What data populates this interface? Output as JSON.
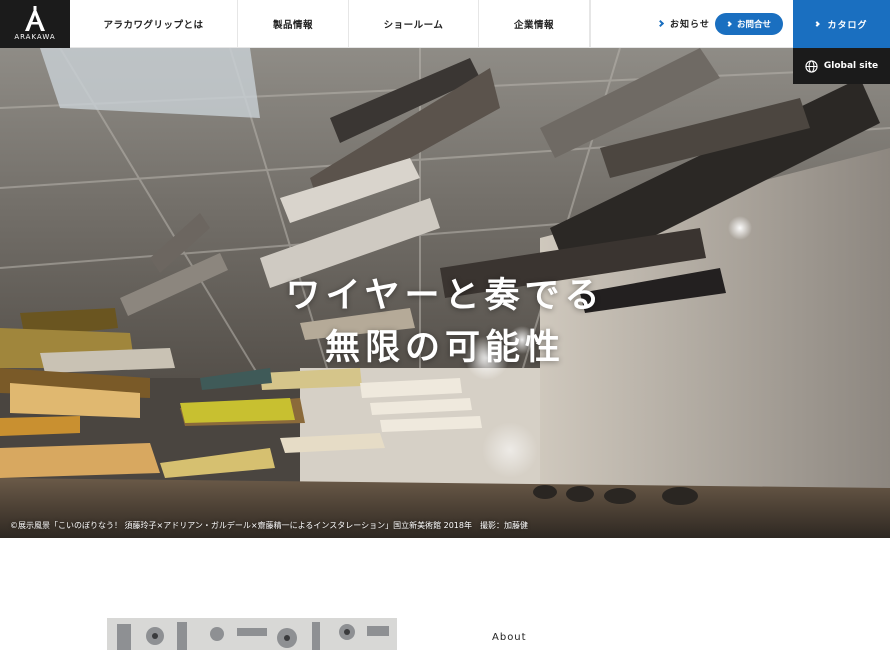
{
  "brand": {
    "name": "ARAKAWA"
  },
  "nav": {
    "items": [
      {
        "label": "アラカワグリップとは"
      },
      {
        "label": "製品情報"
      },
      {
        "label": "ショールーム"
      },
      {
        "label": "企業情報"
      }
    ]
  },
  "header_actions": {
    "news": "お知らせ",
    "contact": "お問合せ",
    "catalog": "カタログ"
  },
  "global_site": "Global site",
  "hero": {
    "headline_line1": "ワイヤーと奏でる",
    "headline_line2": "無限の可能性",
    "caption": "©展示風景「こいのぼりなう！ 須藤玲子×アドリアン・ガルデール×齋藤精一によるインスタレーション」国立新美術館 2018年　撮影：加藤健"
  },
  "section": {
    "about_label": "About"
  },
  "colors": {
    "accent": "#1a6fc0",
    "dark": "#1b1b1b"
  },
  "icons": [
    "logo-a-icon",
    "chevron-right-icon",
    "globe-icon"
  ]
}
